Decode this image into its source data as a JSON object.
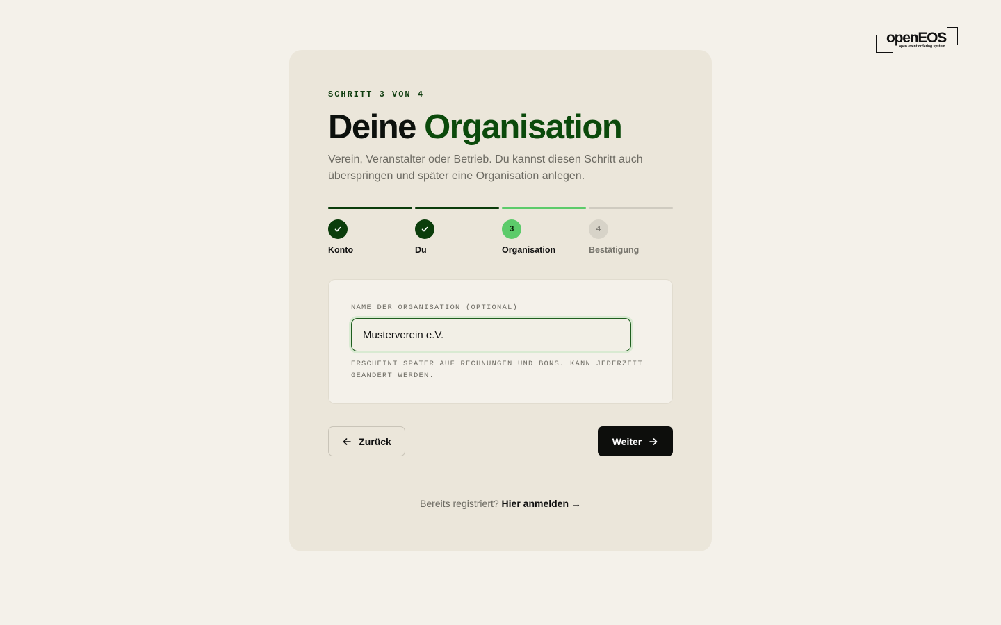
{
  "logo": {
    "wordmark": "openEOS",
    "tagline": "open event ordering system"
  },
  "header": {
    "step_counter": "SCHRITT 3 VON 4",
    "title_plain": "Deine",
    "title_accent": "Organisation",
    "subtitle": "Verein, Veranstalter oder Betrieb. Du kannst diesen Schritt auch überspringen und später eine Organisation anlegen."
  },
  "progress": {
    "current_step": 3,
    "total_steps": 4,
    "steps": [
      {
        "label": "Konto",
        "state": "done",
        "number": "1"
      },
      {
        "label": "Du",
        "state": "done",
        "number": "2"
      },
      {
        "label": "Organisation",
        "state": "active",
        "number": "3"
      },
      {
        "label": "Bestätigung",
        "state": "todo",
        "number": "4"
      }
    ]
  },
  "form": {
    "org_name_label": "NAME DER ORGANISATION (OPTIONAL)",
    "org_name_value": "Musterverein e.V.",
    "org_name_hint": "ERSCHEINT SPÄTER AUF RECHNUNGEN UND BONS. KANN JEDERZEIT GEÄNDERT WERDEN."
  },
  "actions": {
    "back_label": "Zurück",
    "next_label": "Weiter"
  },
  "footer": {
    "prompt": "Bereits registriert?",
    "login_link": "Hier anmelden →"
  },
  "colors": {
    "page_background": "#f4f1ea",
    "card_background": "#ebe6da",
    "accent_dark_green": "#0b3d0b",
    "accent_light_green": "#5ccb6a",
    "primary_button": "#0d0e0c"
  }
}
